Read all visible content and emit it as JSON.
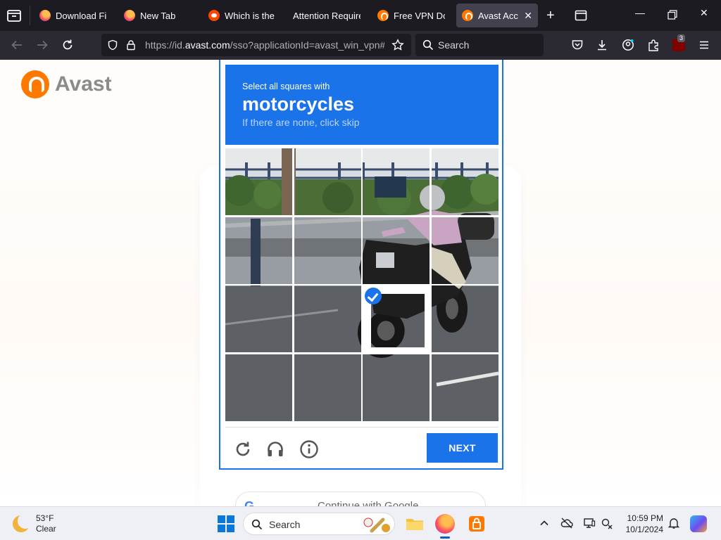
{
  "browser": {
    "tabs": [
      {
        "title": "Download Fire",
        "favicon": "firefox-icon",
        "active": false
      },
      {
        "title": "New Tab",
        "favicon": "firefox-icon",
        "active": false
      },
      {
        "title": "Which is the be",
        "favicon": "reddit-icon",
        "active": false
      },
      {
        "title": "Attention Required",
        "favicon": "none",
        "active": false
      },
      {
        "title": "Free VPN Down",
        "favicon": "avast-icon",
        "active": false
      },
      {
        "title": "Avast Accou",
        "favicon": "avast-icon",
        "active": true
      }
    ],
    "url_prefix": "https://id.",
    "url_domain": "avast.com",
    "url_path": "/sso?applicationId=avast_win_vpn#/",
    "search_placeholder": "Search",
    "extension_badge": "3"
  },
  "page": {
    "logo_text": "Avast",
    "google_button": "Continue with Google",
    "google_letter": "G"
  },
  "captcha": {
    "instruction_small": "Select all squares with",
    "target_word": "motorcycles",
    "hint": "If there are none, click skip",
    "next_label": "NEXT",
    "selected_tiles": [
      10
    ],
    "accent": "#1a73e8"
  },
  "taskbar": {
    "weather_temp": "53°F",
    "weather_desc": "Clear",
    "search_placeholder": "Search",
    "time": "10:59 PM",
    "date": "10/1/2024"
  }
}
